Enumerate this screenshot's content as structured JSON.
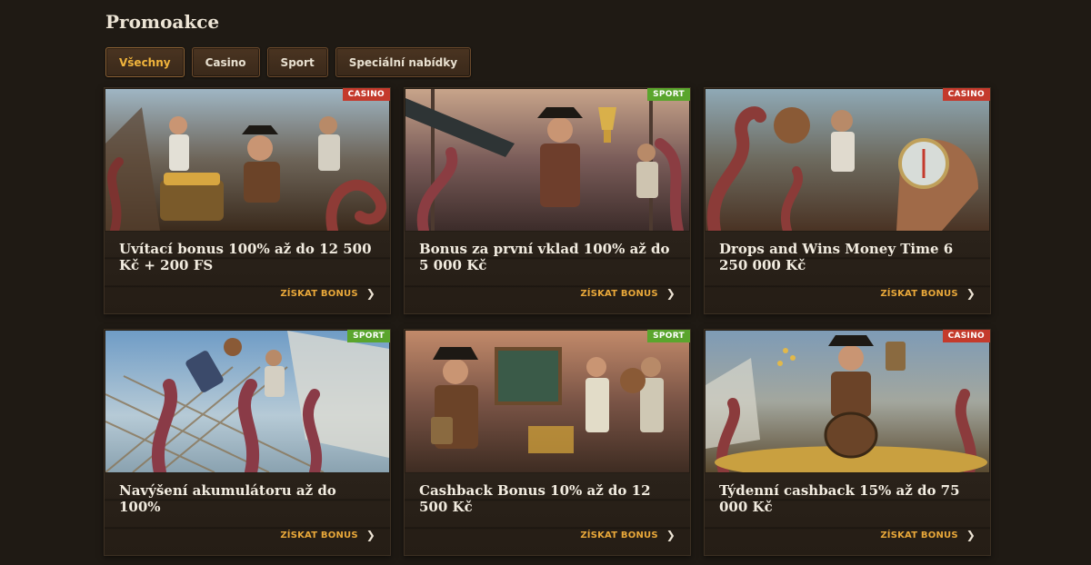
{
  "page": {
    "title": "Promoakce"
  },
  "tabs": [
    {
      "label": "Všechny",
      "active": true
    },
    {
      "label": "Casino",
      "active": false
    },
    {
      "label": "Sport",
      "active": false
    },
    {
      "label": "Speciální nabídky",
      "active": false
    }
  ],
  "colors": {
    "accent": "#f0b43c",
    "casino_badge": "#c43a2c",
    "sport_badge": "#5aa52d",
    "background": "#1f1a14"
  },
  "cards": [
    {
      "badge": "CASINO",
      "title": "Uvítací bonus 100% až do 12 500 Kč + 200 FS",
      "cta": "ZÍSKAT BONUS",
      "image": "pirates-treasure-chest-octopus"
    },
    {
      "badge": "SPORT",
      "title": "Bonus za první vklad 100% až do 5 000 Kč",
      "cta": "ZÍSKAT BONUS",
      "image": "pirate-captain-trophy-octopus"
    },
    {
      "badge": "CASINO",
      "title": "Drops and Wins Money Time 6 250 000 Kč",
      "cta": "ZÍSKAT BONUS",
      "image": "pirate-compass-football-octopus"
    },
    {
      "badge": "SPORT",
      "title": "Navýšení akumulátoru až do 100%",
      "cta": "ZÍSKAT BONUS",
      "image": "kraken-ship-net-football"
    },
    {
      "badge": "SPORT",
      "title": "Cashback Bonus 10% až do 12 500 Kč",
      "cta": "ZÍSKAT BONUS",
      "image": "pirates-tactics-board-tankard"
    },
    {
      "badge": "CASINO",
      "title": "Týdenní cashback 15% až do 75 000 Kč",
      "cta": "ZÍSKAT BONUS",
      "image": "pirate-barrel-coins-tankard"
    }
  ]
}
